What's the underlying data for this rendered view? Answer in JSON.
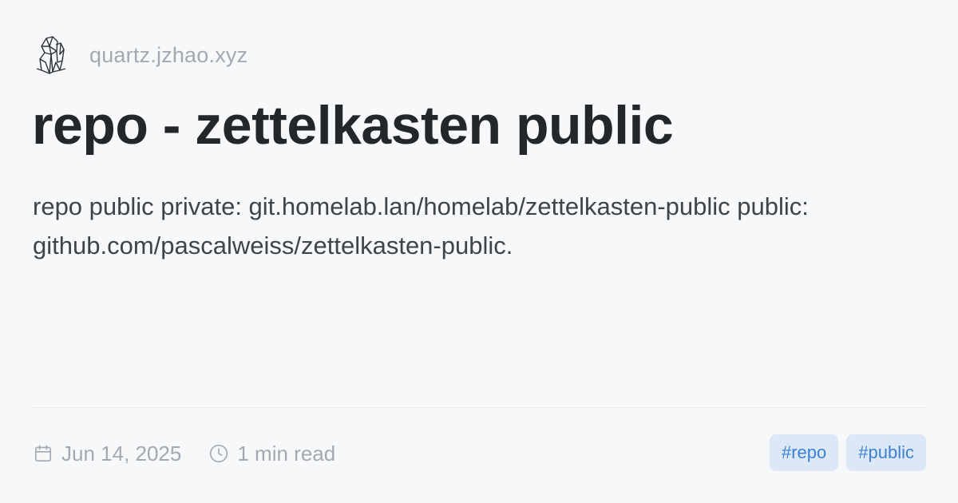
{
  "site": {
    "domain": "quartz.jzhao.xyz",
    "logo_icon": "quartz-crystal-icon"
  },
  "page": {
    "title": "repo - zettelkasten public",
    "description": "repo public private: git.homelab.lan/homelab/zettelkasten-public public: github.com/pascalweiss/zettelkasten-public."
  },
  "meta": {
    "date": "Jun 14, 2025",
    "date_icon": "calendar-icon",
    "reading_time": "1 min read",
    "reading_icon": "clock-icon"
  },
  "tags": [
    {
      "label": "#repo"
    },
    {
      "label": "#public"
    }
  ],
  "colors": {
    "background": "#f7f8fa",
    "title": "#23262b",
    "muted": "#a3a9b3",
    "tag_bg": "#dde8f6",
    "tag_text": "#3b82d6"
  }
}
